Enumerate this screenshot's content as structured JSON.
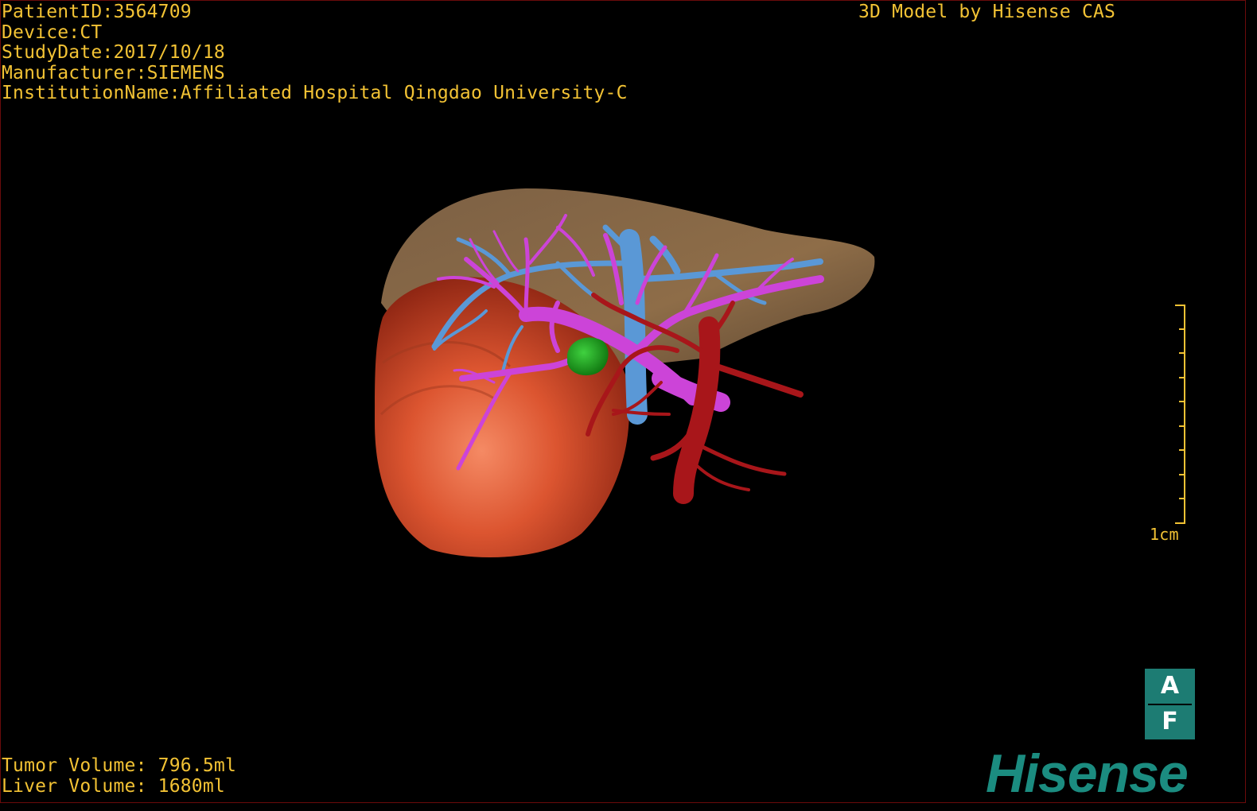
{
  "info": {
    "patient_id": "PatientID:3564709",
    "device": "Device:CT",
    "study_date": "StudyDate:2017/10/18",
    "manufacturer": "Manufacturer:SIEMENS",
    "institution": "InstitutionName:Affiliated Hospital Qingdao University-C"
  },
  "header": {
    "model_credit": "3D Model by Hisense CAS"
  },
  "volumes": {
    "tumor": "Tumor Volume: 796.5ml",
    "liver": "Liver Volume: 1680ml"
  },
  "scale": {
    "label": "1cm"
  },
  "orientation": {
    "top": "A",
    "bottom": "F"
  },
  "brand": {
    "logo_text": "Hisense"
  },
  "colors": {
    "overlay_text": "#f2c234",
    "liver": "#8a6a46",
    "tumor": "#d8502b",
    "portal_vein": "#cc44d8",
    "hepatic_vein": "#5a98d6",
    "artery": "#a8161a",
    "gallbladder": "#1ea01e",
    "brand": "#1b8c80"
  }
}
